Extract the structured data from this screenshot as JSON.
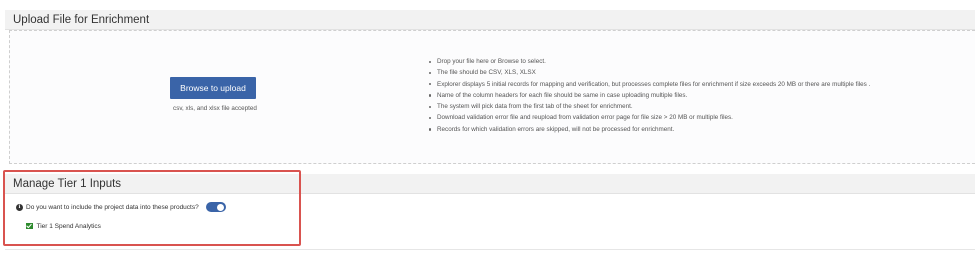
{
  "upload": {
    "title": "Upload File for Enrichment",
    "browse_label": "Browse to upload",
    "accepted_note": "csv, xls, and xlsx file accepted",
    "instructions": [
      "Drop your file here or Browse to select.",
      "The file should be CSV, XLS, XLSX",
      "Explorer displays 5 initial records for mapping and verification, but processes complete files for enrichment if size exceeds 20 MB or there are multiple files .",
      "Name of the column headers for each file should be same in case uploading multiple files.",
      "The system will pick data from the first tab of the sheet for enrichment.",
      "Download validation error file and reupload from validation error page for file size > 20 MB or multiple files.",
      "Records for which validation errors are skipped, will not be processed for enrichment."
    ]
  },
  "tier": {
    "title": "Manage Tier 1 Inputs",
    "question": "Do you want to include the project data into these products?",
    "toggle_on": true,
    "checkbox_label": "Tier 1 Spend Analytics",
    "checkbox_checked": true
  },
  "icons": {
    "info": "info-icon",
    "check": "check-icon"
  },
  "colors": {
    "primary": "#3a64a8",
    "highlight": "#d9534f",
    "checkbox": "#2e8b2e"
  }
}
